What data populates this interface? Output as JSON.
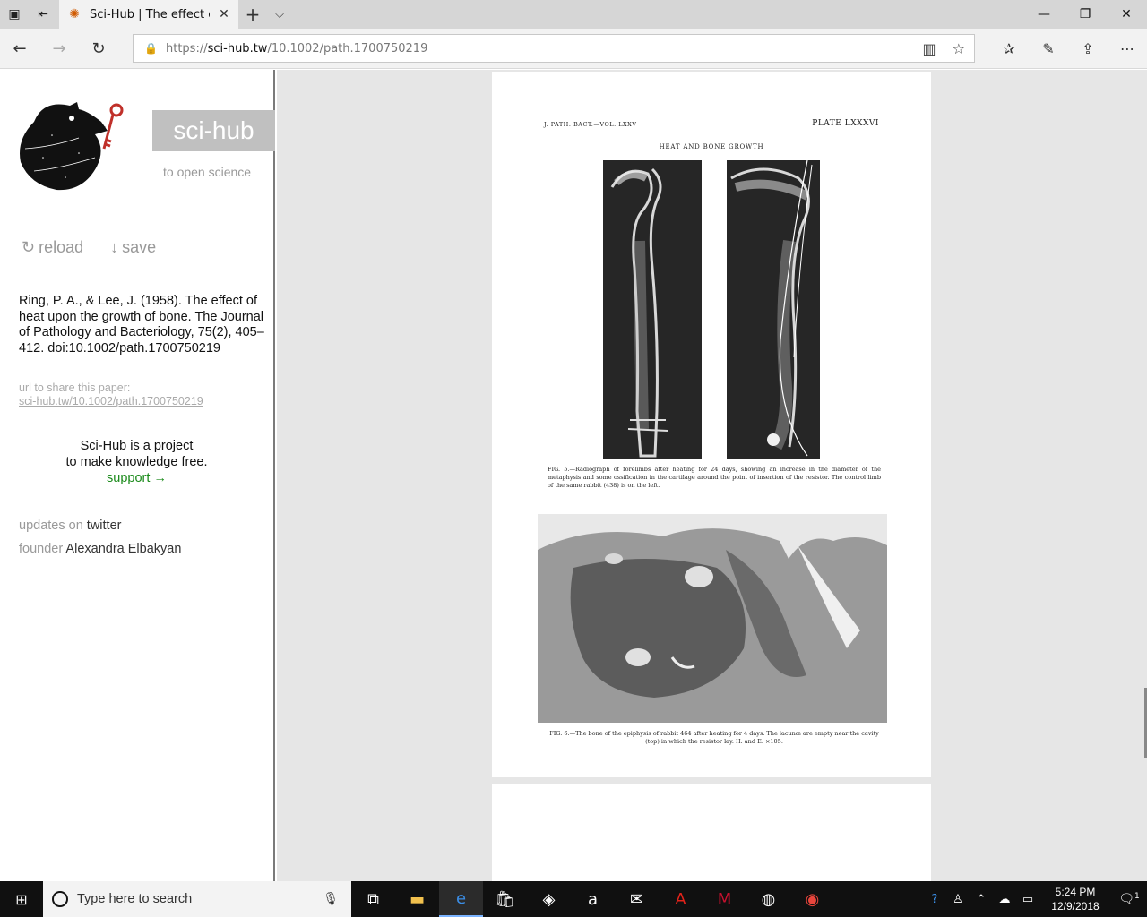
{
  "browser": {
    "tab_title": "Sci-Hub | The effect of h",
    "url_prefix": "https://",
    "url_host": "sci-hub.tw",
    "url_path": "/10.1002/path.1700750219"
  },
  "sidebar": {
    "brand": "sci-hub",
    "tagline": "to open science",
    "reload_label": "reload",
    "save_label": "save",
    "citation": "Ring, P. A., & Lee, J. (1958). The effect of heat upon the growth of bone. The Journal of Pathology and Bacteriology, 75(2), 405–412. doi:10.1002/path.1700750219",
    "share_label": "url to share this paper:",
    "share_url": "sci-hub.tw/10.1002/path.1700750219",
    "project_line1": "Sci-Hub is a project",
    "project_line2": "to make knowledge free.",
    "support_label": "support →",
    "updates_label": "updates on",
    "updates_link": "twitter",
    "founder_label": "founder",
    "founder_link": "Alexandra Elbakyan"
  },
  "pdf": {
    "header_left": "J. PATH. BACT.—VOL. LXXV",
    "header_right": "PLATE LXXXVI",
    "plate_title": "HEAT AND BONE GROWTH",
    "caption_fig5": "FIG. 5.—Radiograph of forelimbs after heating for 24 days, showing an increase in the diameter of the metaphysis and some ossification in the cartilage around the point of insertion of the resistor. The control limb of the same rabbit (438) is on the left.",
    "caption_fig6": "FIG. 6.—The bone of the epiphysis of rabbit 464 after heating for 4 days. The lacunæ are empty near the cavity (top) in which the resistor lay. H. and E. ×105."
  },
  "taskbar": {
    "search_placeholder": "Type here to search",
    "time": "5:24 PM",
    "date": "12/9/2018",
    "notification_count": "1"
  },
  "colors": {
    "brand_box": "#c0c0c0",
    "support_link": "#1a8a1a",
    "taskbar": "#101010"
  }
}
